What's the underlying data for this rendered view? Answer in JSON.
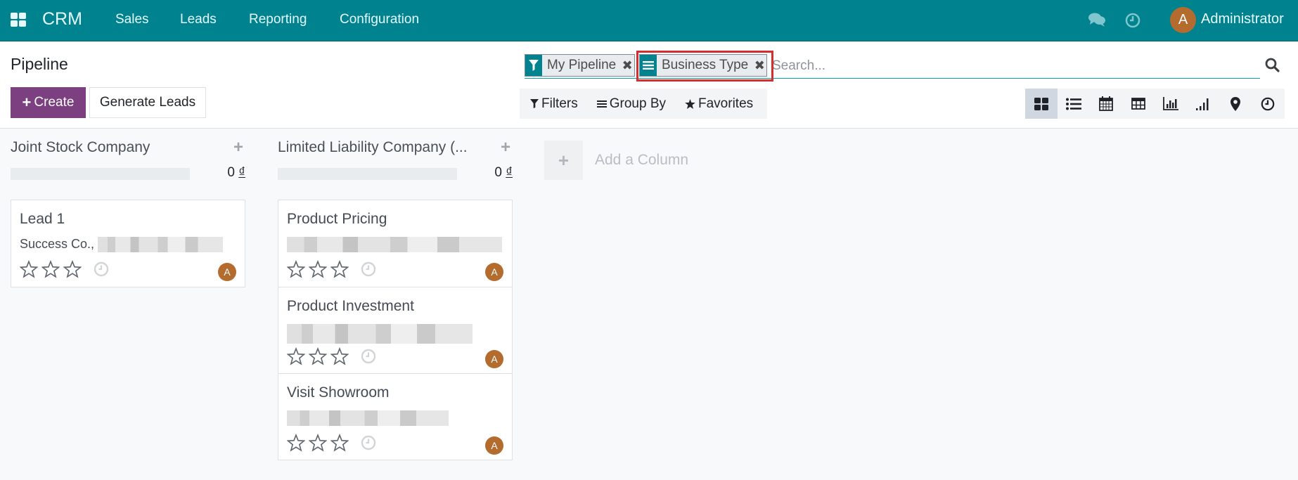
{
  "navbar": {
    "apps_icon": "grid-icon",
    "brand": "CRM",
    "menu": [
      "Sales",
      "Leads",
      "Reporting",
      "Configuration"
    ],
    "chat_icon": "comments-icon",
    "activity_icon": "clock-icon",
    "user_initial": "A",
    "user_name": "Administrator",
    "accent": "#00838f"
  },
  "control": {
    "title": "Pipeline",
    "create_label": "Create",
    "generate_label": "Generate Leads",
    "search": {
      "facets": [
        {
          "icon": "filter-icon",
          "label": "My Pipeline"
        },
        {
          "icon": "group-by-icon",
          "label": "Business Type",
          "highlighted": true
        }
      ],
      "placeholder": "Search..."
    },
    "filters_label": "Filters",
    "groupby_label": "Group By",
    "favorites_label": "Favorites",
    "views": [
      "kanban",
      "list",
      "calendar",
      "pivot",
      "graph",
      "cohort",
      "map",
      "activity"
    ],
    "active_view": "kanban"
  },
  "kanban": {
    "columns": [
      {
        "title": "Joint Stock Company",
        "amount": "0",
        "currency": "₫",
        "cards": [
          {
            "title": "Lead 1",
            "subtitle": "Success Co., ",
            "subtitle_redacted": true,
            "stars": 0,
            "avatar": "A"
          }
        ]
      },
      {
        "title": "Limited Liability Company (...",
        "amount": "0",
        "currency": "₫",
        "cards": [
          {
            "title": "Product Pricing",
            "subtitle": "",
            "subtitle_redacted": true,
            "stars": 0,
            "avatar": "A"
          },
          {
            "title": "Product Investment",
            "subtitle": "",
            "subtitle_redacted": true,
            "stars": 0,
            "avatar": "A"
          },
          {
            "title": "Visit Showroom",
            "subtitle": "",
            "subtitle_redacted": true,
            "stars": 0,
            "avatar": "A"
          }
        ]
      }
    ],
    "add_column_label": "Add a Column"
  }
}
